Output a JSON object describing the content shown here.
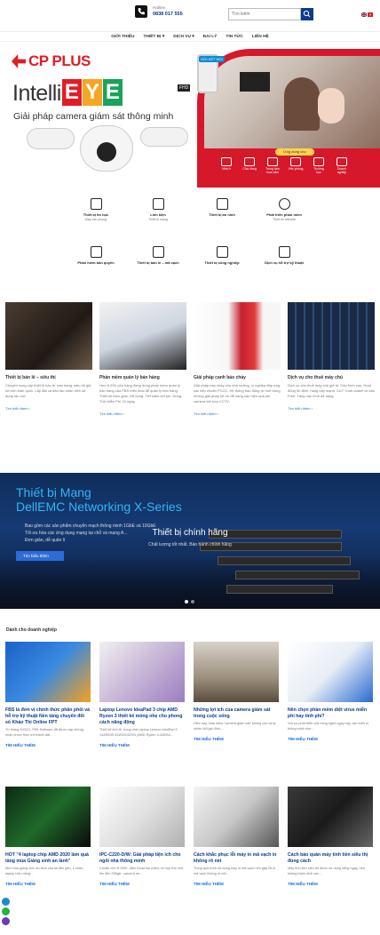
{
  "header": {
    "hotline_label": "Hotline",
    "hotline_number": "0838 017 555",
    "search_placeholder": "Tìm kiếm"
  },
  "nav": [
    "GIỚI THIỆU",
    "THIẾT BỊ ▾",
    "DỊCH VỤ ▾",
    "ĐẠI LÝ",
    "TIN TỨC",
    "LIÊN HỆ"
  ],
  "hero": {
    "brand": "CP PLUS",
    "intelli": "Intelli",
    "eye_letters": [
      "E",
      "Y",
      "E"
    ],
    "eye_colors": [
      "#e21d26",
      "#f5a623",
      "#1aa35b"
    ],
    "fhd": "FHD",
    "subtitle": "Giải pháp camera giám sát thông minh",
    "badge": "GỬI KẾT NỐI",
    "app_button": "Ứng dụng cho",
    "icons": [
      "Nhà ở",
      "Cửa hàng",
      "Trung tâm mua sắm",
      "Văn phòng",
      "Trường học",
      "Doanh nghiệp"
    ]
  },
  "services": [
    {
      "title": "Thiết bị tin học",
      "sub": "Máy văn phòng"
    },
    {
      "title": "Linh kiện",
      "sub": "Thiết bị mạng"
    },
    {
      "title": "Thiết bị an ninh",
      "sub": ""
    },
    {
      "title": "Phát triển phần mềm",
      "sub": "Thiết kế website"
    },
    {
      "title": "Phần mềm bản quyền",
      "sub": ""
    },
    {
      "title": "Thiết bị bán lẻ – mã vạch",
      "sub": ""
    },
    {
      "title": "Thiết bị công nghiệp",
      "sub": ""
    },
    {
      "title": "Dịch vụ hỗ trợ kỹ thuật",
      "sub": ""
    }
  ],
  "products": [
    {
      "title": "Thiết bị bán lẻ – siêu thị",
      "desc": "Chuyên cung cấp thiết bị bán lẻ, bán hàng, siêu thị giá tốt trên toàn quốc. Lắp đặt và đào tạo nhân viên sử dụng tận nơi.",
      "link": "Tìm hiểu thêm  ›"
    },
    {
      "title": "Phần mềm quản lý bán hàng",
      "desc": "Hơn 5.000 cửa hàng đang dùng phần mềm quản lý bán hàng của FBS triển khai để quản lý bán hàng. Thiết kế theo giao, Dễ dùng. Tiết kiệm chi phí. Dùng Thử Miễn Phí 15 ngày.",
      "link": "Tìm hiểu thêm  ›"
    },
    {
      "title": "Giải pháp canh báo cháy",
      "desc": "Giải pháp báo cháy cho nhà xưởng, xí nghiệp đáp ứng các tiêu chuẩn PCCC. Hệ thống báo động tự mới trong những giải pháp tối ưu để nâng cao hiệu quả khi camera kết hợp CCTV.",
      "link": "Tìm hiểu thêm  ›"
    },
    {
      "title": "Dịch vụ cho thuê máy chủ",
      "desc": "Dịch vụ cho thuê máy chủ giá rẻ, Cấu hình cao, Hoạt động ổn định, hàng cấp mạnh, 24/7. Kinh doanh tự vận Free. Tăng cấu hình dễ dàng.",
      "link": "Tìm hiểu thêm  ›"
    }
  ],
  "banner": {
    "title1": "Thiết bị Mạng",
    "title2": "DellEMC Networking X-Series",
    "bullets": [
      "Bao gồm các sản phẩm chuyển mạch thông minh 1GbE và 10GbE",
      "Tối ưu hóa các ứng dụng mạng tại chỗ và mạng A...",
      "Đơn giản, dễ quản lí"
    ],
    "button": "Tìm hiểu thêm",
    "caption": "Thiết bị chính hãng",
    "caption_sub": "Chất lượng tốt nhất. Bảo hành chính hãng"
  },
  "business": {
    "heading": "Dành cho doanh nghiệp",
    "posts": [
      {
        "title": "FBS là đơn vị chính thức phân phối và hỗ trợ kỹ thuật Nền tảng chuyển đổi số Khảo Thi Online FPT",
        "desc": "Từ tháng 9/2021, FBS Software đã được cấp chứng nhận chính thức trở thành đại...",
        "link": "TÌM HIỂU THÊM"
      },
      {
        "title": "Laptop Lenovo IdeaPad 3 chip AMD Ryzen 3 thiết kế mỏng nhẹ cho phong cách năng động",
        "desc": "Thiết kế tinh tế, trong nhà Laptop Lenovo IdeaPad 3 14ARE05 81W30032VN (AMD Ryzen 3-4300U/...",
        "link": "TÌM HIỂU THÊM"
      },
      {
        "title": "Những lợi ích của camera giám sát trong cuộc sống",
        "desc": "Hiện nay, khái niệm \"camera giám sát\" không còn xa lạ nhiều đối gia đình,...",
        "link": "TÌM HIỂU THÊM"
      },
      {
        "title": "Nên chọn phần mềm diệt virus miễn phí hay tính phí?",
        "desc": "Với sự phát triển của công nghệ ngày nay, các thiết bị thông minh như...",
        "link": "TÌM HIỂU THÊM"
      },
      {
        "title": "HOT \"4 laptop chip AMD 2020 làm quá tầng mùa Giáng sinh an lành\"",
        "desc": "Mới mùa giáng sinh an lành của lại đến gần, 1 chiếc laptop hiệu năng...",
        "link": "TÌM HIỂU THÊM"
      },
      {
        "title": "IPC-C220-D/W: Giải pháp tiện ích cho ngôi nhà thông minh",
        "desc": "Chuẩn nén H.265+, điện thoại hai chiều, tờ hợp thẻ nhớ lên đến 256gb...camera an...",
        "link": "TÌM HIỂU THÊM"
      },
      {
        "title": "Cách khắc phục lỗi máy in mã vạch in không rõ nét",
        "desc": "Trong quá trình sử dụng máy in mã vạch nếu gặp lỗi in mã vạch không rõ nét...",
        "link": "TÌM HIỂU THÊM"
      },
      {
        "title": "Cách bảo quản máy tính tiền siêu thị đúng cách",
        "desc": "Máy tính tiền siêu thị được sử dụng hằng ngày, nếu không tránh khỏi các...",
        "link": "TÌM HIỂU THÊM"
      }
    ]
  },
  "colors": {
    "accent": "#0b3b8c",
    "link": "#1a6fd6",
    "red": "#d6182a"
  }
}
